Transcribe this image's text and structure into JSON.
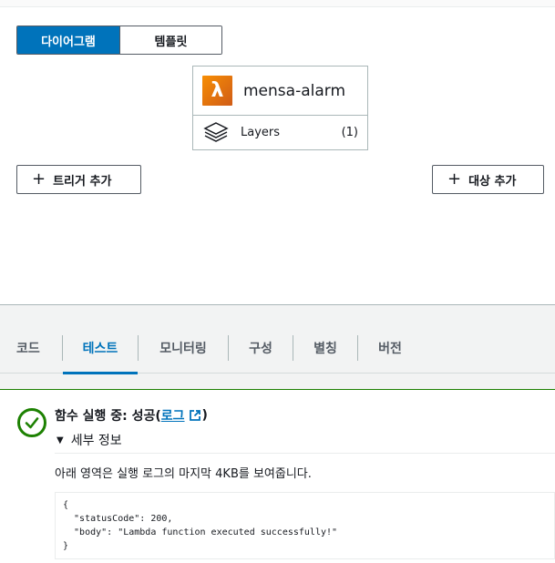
{
  "view_toggle": {
    "diagram_label": "다이어그램",
    "template_label": "템플릿"
  },
  "function": {
    "name": "mensa-alarm",
    "icon": "lambda-icon",
    "layers_label": "Layers",
    "layers_count": "(1)"
  },
  "buttons": {
    "add_trigger": "트리거 추가",
    "add_destination": "대상 추가"
  },
  "tabs": [
    {
      "label": "코드"
    },
    {
      "label": "테스트",
      "active": true
    },
    {
      "label": "모니터링"
    },
    {
      "label": "구성"
    },
    {
      "label": "별칭"
    },
    {
      "label": "버전"
    }
  ],
  "result": {
    "status_prefix": "함수 실행 중: 성공(",
    "log_link": "로그",
    "status_suffix": ")",
    "details_label": "세부 정보",
    "description": "아래 영역은 실행 로그의 마지막 4KB를 보여줍니다.",
    "code_output": "{\n  \"statusCode\": 200,\n  \"body\": \"Lambda function executed successfully!\"\n}"
  },
  "colors": {
    "accent": "#0073bb",
    "success": "#1d8102",
    "lambda_orange": "#f78e04"
  }
}
